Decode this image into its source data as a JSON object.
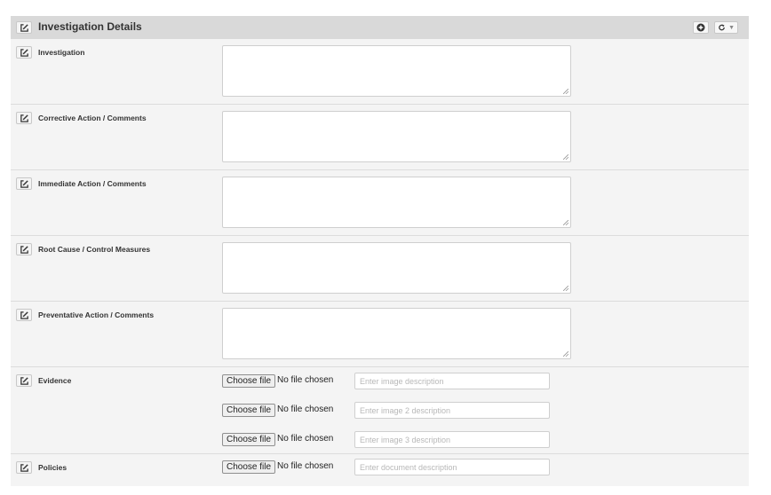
{
  "panel": {
    "title": "Investigation Details",
    "tools": [
      {
        "icon": "plus-circle-icon"
      },
      {
        "icon": "refresh-icon"
      }
    ]
  },
  "text_fields": [
    {
      "label": "Investigation",
      "value": ""
    },
    {
      "label": "Corrective Action / Comments",
      "value": ""
    },
    {
      "label": "Immediate Action / Comments",
      "value": ""
    },
    {
      "label": "Root Cause / Control Measures",
      "value": ""
    },
    {
      "label": "Preventative Action / Comments",
      "value": ""
    }
  ],
  "evidence": {
    "label": "Evidence",
    "files": [
      {
        "button": "Choose file",
        "status": "No file chosen",
        "placeholder": "Enter image description"
      },
      {
        "button": "Choose file",
        "status": "No file chosen",
        "placeholder": "Enter image 2 description"
      },
      {
        "button": "Choose file",
        "status": "No file chosen",
        "placeholder": "Enter image 3 description"
      }
    ]
  },
  "policies": {
    "label": "Policies",
    "files": [
      {
        "button": "Choose file",
        "status": "No file chosen",
        "placeholder": "Enter document description"
      }
    ]
  }
}
